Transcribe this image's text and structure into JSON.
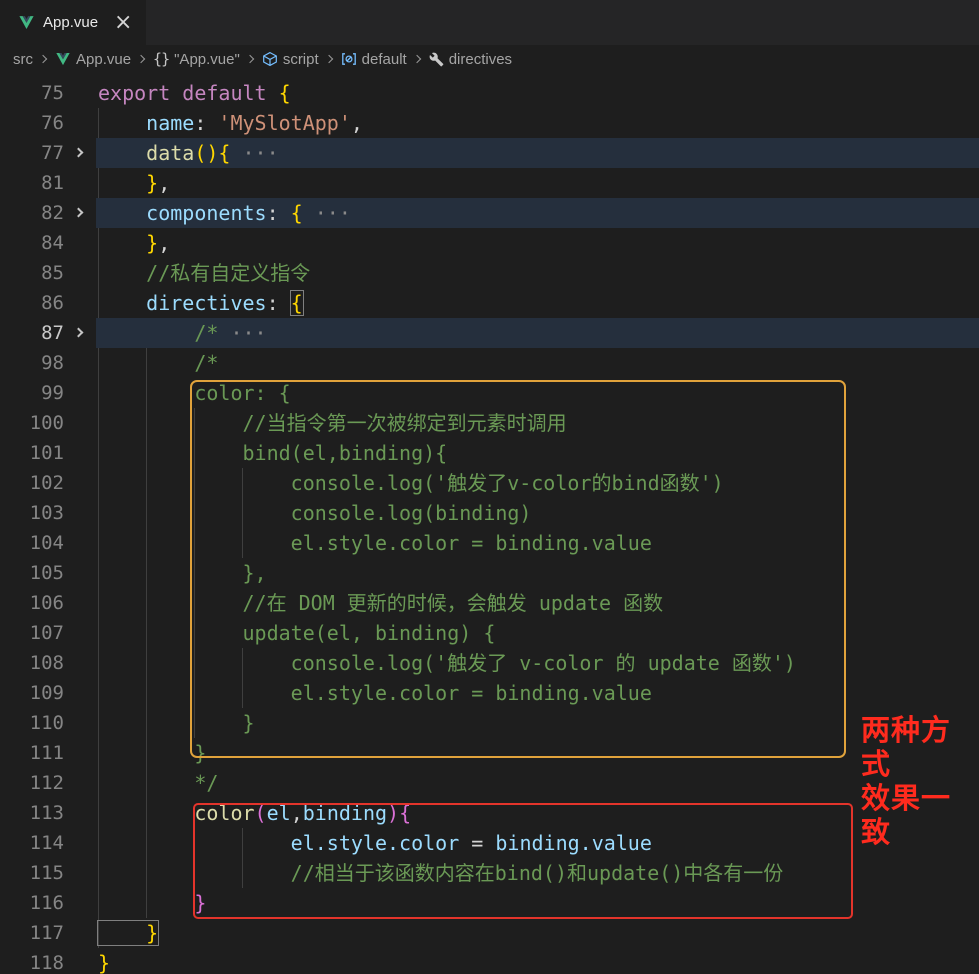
{
  "colors": {
    "editor_bg": "#1e1e1e",
    "tabstrip_bg": "#252526",
    "fold_band": "#252f3d",
    "accent_orange": "#E0A23B",
    "accent_red": "#E3342B",
    "label_red": "#FF2B1E",
    "vue_green": "#41B883",
    "vue_dark": "#35495E",
    "symbol_blue": "#75BEFF"
  },
  "tab": {
    "title": "App.vue",
    "icon": "vue-logo-icon",
    "close_icon": "×"
  },
  "breadcrumb": {
    "items": [
      {
        "label": "src",
        "icon": null
      },
      {
        "label": "App.vue",
        "icon": "vue-logo-icon"
      },
      {
        "label": "\"App.vue\"",
        "icon": "braces-icon",
        "icon_glyph": "{}"
      },
      {
        "label": "script",
        "icon": "module-cube-icon"
      },
      {
        "label": "default",
        "icon": "symbol-variable-icon"
      },
      {
        "label": "directives",
        "icon": "wrench-icon"
      }
    ]
  },
  "annotations": {
    "side_label_line1": "两种方式",
    "side_label_line2": "效果一致"
  },
  "editor": {
    "guides": [
      {
        "col": 0,
        "from": 1,
        "to": 28
      },
      {
        "col": 4,
        "from": 8,
        "to": 27
      },
      {
        "col": 8,
        "from": 11,
        "to": 21
      },
      {
        "col": 8,
        "from": 25,
        "to": 26
      },
      {
        "col": 12,
        "from": 13,
        "to": 15
      },
      {
        "col": 12,
        "from": 19,
        "to": 20
      },
      {
        "col": 12,
        "from": 25,
        "to": 26
      }
    ],
    "lines": [
      {
        "n": "75",
        "s": [
          [
            "kw",
            "export default "
          ],
          [
            "b1",
            "{"
          ]
        ]
      },
      {
        "n": "76",
        "s": [
          [
            "pv",
            "    name"
          ],
          [
            "pu",
            ": "
          ],
          [
            "st",
            "'MySlotApp'"
          ],
          [
            "pu",
            ","
          ]
        ]
      },
      {
        "n": "77",
        "fold": true,
        "hl": true,
        "s": [
          [
            "fn",
            "    data"
          ],
          [
            "b1",
            "(){"
          ],
          [
            "dots",
            " ···"
          ]
        ]
      },
      {
        "n": "81",
        "s": [
          [
            "b1",
            "    }"
          ],
          [
            "pu",
            ","
          ]
        ]
      },
      {
        "n": "82",
        "fold": true,
        "hl": true,
        "s": [
          [
            "pv",
            "    components"
          ],
          [
            "pu",
            ": "
          ],
          [
            "b1",
            "{"
          ],
          [
            "dots",
            " ···"
          ]
        ]
      },
      {
        "n": "84",
        "s": [
          [
            "b1",
            "    }"
          ],
          [
            "pu",
            ","
          ]
        ]
      },
      {
        "n": "85",
        "s": [
          [
            "cm",
            "    //私有自定义指令"
          ]
        ]
      },
      {
        "n": "86",
        "s": [
          [
            "pv",
            "    directives"
          ],
          [
            "pu",
            ": "
          ],
          [
            "b1 bm",
            "{"
          ]
        ]
      },
      {
        "n": "87",
        "fold": true,
        "hl": true,
        "active": true,
        "s": [
          [
            "cm",
            "        /*"
          ],
          [
            "dots",
            " ···"
          ]
        ]
      },
      {
        "n": "98",
        "s": [
          [
            "cm",
            "        /*"
          ]
        ]
      },
      {
        "n": "99",
        "s": [
          [
            "cm",
            "        color: {"
          ]
        ]
      },
      {
        "n": "100",
        "s": [
          [
            "cm",
            "            //当指令第一次被绑定到元素时调用"
          ]
        ]
      },
      {
        "n": "101",
        "s": [
          [
            "cm",
            "            bind(el,binding){"
          ]
        ]
      },
      {
        "n": "102",
        "s": [
          [
            "cm",
            "                console.log('触发了v-color的bind函数')"
          ]
        ]
      },
      {
        "n": "103",
        "s": [
          [
            "cm",
            "                console.log(binding)"
          ]
        ]
      },
      {
        "n": "104",
        "s": [
          [
            "cm",
            "                el.style.color = binding.value"
          ]
        ]
      },
      {
        "n": "105",
        "s": [
          [
            "cm",
            "            },"
          ]
        ]
      },
      {
        "n": "106",
        "s": [
          [
            "cm",
            "            //在 DOM 更新的时候，会触发 update 函数"
          ]
        ]
      },
      {
        "n": "107",
        "s": [
          [
            "cm",
            "            update(el, binding) {"
          ]
        ]
      },
      {
        "n": "108",
        "s": [
          [
            "cm",
            "                console.log('触发了 v-color 的 update 函数')"
          ]
        ]
      },
      {
        "n": "109",
        "s": [
          [
            "cm",
            "                el.style.color = binding.value"
          ]
        ]
      },
      {
        "n": "110",
        "s": [
          [
            "cm",
            "            }"
          ]
        ]
      },
      {
        "n": "111",
        "s": [
          [
            "cm",
            "        }"
          ]
        ]
      },
      {
        "n": "112",
        "s": [
          [
            "cm",
            "        */"
          ]
        ]
      },
      {
        "n": "113",
        "s": [
          [
            "fn",
            "        color"
          ],
          [
            "b2",
            "("
          ],
          [
            "pv",
            "el"
          ],
          [
            "pu",
            ","
          ],
          [
            "pv",
            "binding"
          ],
          [
            "b2",
            ")"
          ],
          [
            "b2",
            "{"
          ]
        ]
      },
      {
        "n": "114",
        "s": [
          [
            "pv",
            "                el.style.color"
          ],
          [
            "pu",
            " = "
          ],
          [
            "pv",
            "binding.value"
          ]
        ]
      },
      {
        "n": "115",
        "s": [
          [
            "cm",
            "                //相当于该函数内容在bind()和update()中各有一份"
          ]
        ]
      },
      {
        "n": "116",
        "s": [
          [
            "b2",
            "        }"
          ]
        ]
      },
      {
        "n": "117",
        "s": [
          [
            "b1 bm",
            "    }"
          ]
        ]
      },
      {
        "n": "118",
        "s": [
          [
            "b1",
            "}"
          ]
        ]
      }
    ]
  }
}
